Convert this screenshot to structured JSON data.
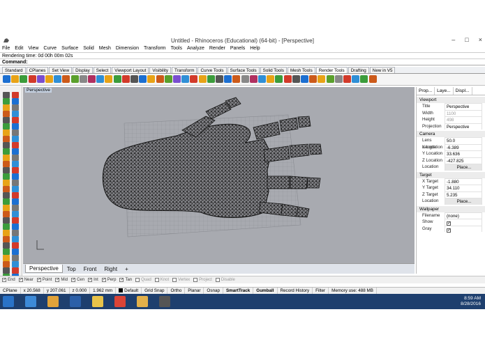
{
  "window": {
    "title": "Untitled - Rhinoceros (Educational) (64-bit) - [Perspective]",
    "minimize": "–",
    "maximize": "□",
    "close": "×"
  },
  "menu": [
    "File",
    "Edit",
    "View",
    "Curve",
    "Surface",
    "Solid",
    "Mesh",
    "Dimension",
    "Transform",
    "Tools",
    "Analyze",
    "Render",
    "Panels",
    "Help"
  ],
  "command_history": "Rendering time: 0d 00h 00m 02s",
  "command_prompt": "Command:",
  "toolbar_tabs": [
    "Standard",
    "CPlanes",
    "Set View",
    "Display",
    "Select",
    "Viewport Layout",
    "Visibility",
    "Transform",
    "Curve Tools",
    "Surface Tools",
    "Solid Tools",
    "Mesh Tools",
    "Render Tools",
    "Drafting",
    "New in V5"
  ],
  "active_toolbar_tab": "Render Tools",
  "viewport": {
    "label": "Perspective",
    "tabs": [
      "Perspective",
      "Top",
      "Front",
      "Right"
    ],
    "add_tab": "+"
  },
  "properties_panel": {
    "tabs": [
      "Prop...",
      "Laye...",
      "Displ..."
    ],
    "sections": {
      "viewport": "Viewport",
      "camera": "Camera",
      "target": "Target",
      "wallpaper": "Wallpaper"
    },
    "viewport_rows": [
      {
        "label": "Title",
        "value": "Perspective"
      },
      {
        "label": "Width",
        "value": "1100"
      },
      {
        "label": "Height",
        "value": "498"
      },
      {
        "label": "Projection",
        "value": "Perspective"
      }
    ],
    "camera_rows": [
      {
        "label": "Lens Length",
        "value": "50.0"
      },
      {
        "label": "X Location",
        "value": "-6.389"
      },
      {
        "label": "Y Location",
        "value": "33.636"
      },
      {
        "label": "Z Location",
        "value": "-427.825"
      },
      {
        "label": "Location",
        "value": "Place..."
      }
    ],
    "target_rows": [
      {
        "label": "X Target",
        "value": "-1.880"
      },
      {
        "label": "Y Target",
        "value": "34.110"
      },
      {
        "label": "Z Target",
        "value": "5.235"
      },
      {
        "label": "Location",
        "value": "Place..."
      }
    ],
    "wallpaper_rows": [
      {
        "label": "Filename",
        "value": "(none)"
      },
      {
        "label": "Show",
        "value": ""
      },
      {
        "label": "Gray",
        "value": ""
      }
    ]
  },
  "osnaps": [
    {
      "label": "End",
      "checked": true
    },
    {
      "label": "Near",
      "checked": true
    },
    {
      "label": "Point",
      "checked": true
    },
    {
      "label": "Mid",
      "checked": true
    },
    {
      "label": "Cen",
      "checked": true
    },
    {
      "label": "Int",
      "checked": true
    },
    {
      "label": "Perp",
      "checked": true
    },
    {
      "label": "Tan",
      "checked": true
    },
    {
      "label": "Quad",
      "checked": false
    },
    {
      "label": "Knot",
      "checked": false
    },
    {
      "label": "Vertex",
      "checked": false
    },
    {
      "label": "Project",
      "checked": false
    },
    {
      "label": "Disable",
      "checked": false
    }
  ],
  "status": {
    "cplane": "CPlane",
    "x": "x 20.568",
    "y": "y 207.061",
    "z": "z 0.000",
    "units": "1.962 mm",
    "layer": "Default",
    "buttons": [
      "Grid Snap",
      "Ortho",
      "Planar",
      "Osnap",
      "SmartTrack",
      "Gumball",
      "Record History",
      "Filter"
    ],
    "bold_buttons": [
      "SmartTrack",
      "Gumball"
    ],
    "memory": "Memory use: 488 MB"
  },
  "taskbar": {
    "time": "8:59 AM",
    "date": "8/28/2016"
  },
  "colors": {
    "viewport_bg": "#a8aab0",
    "taskbar": "#1e3f6e",
    "mesh": "#1a1a1a"
  }
}
